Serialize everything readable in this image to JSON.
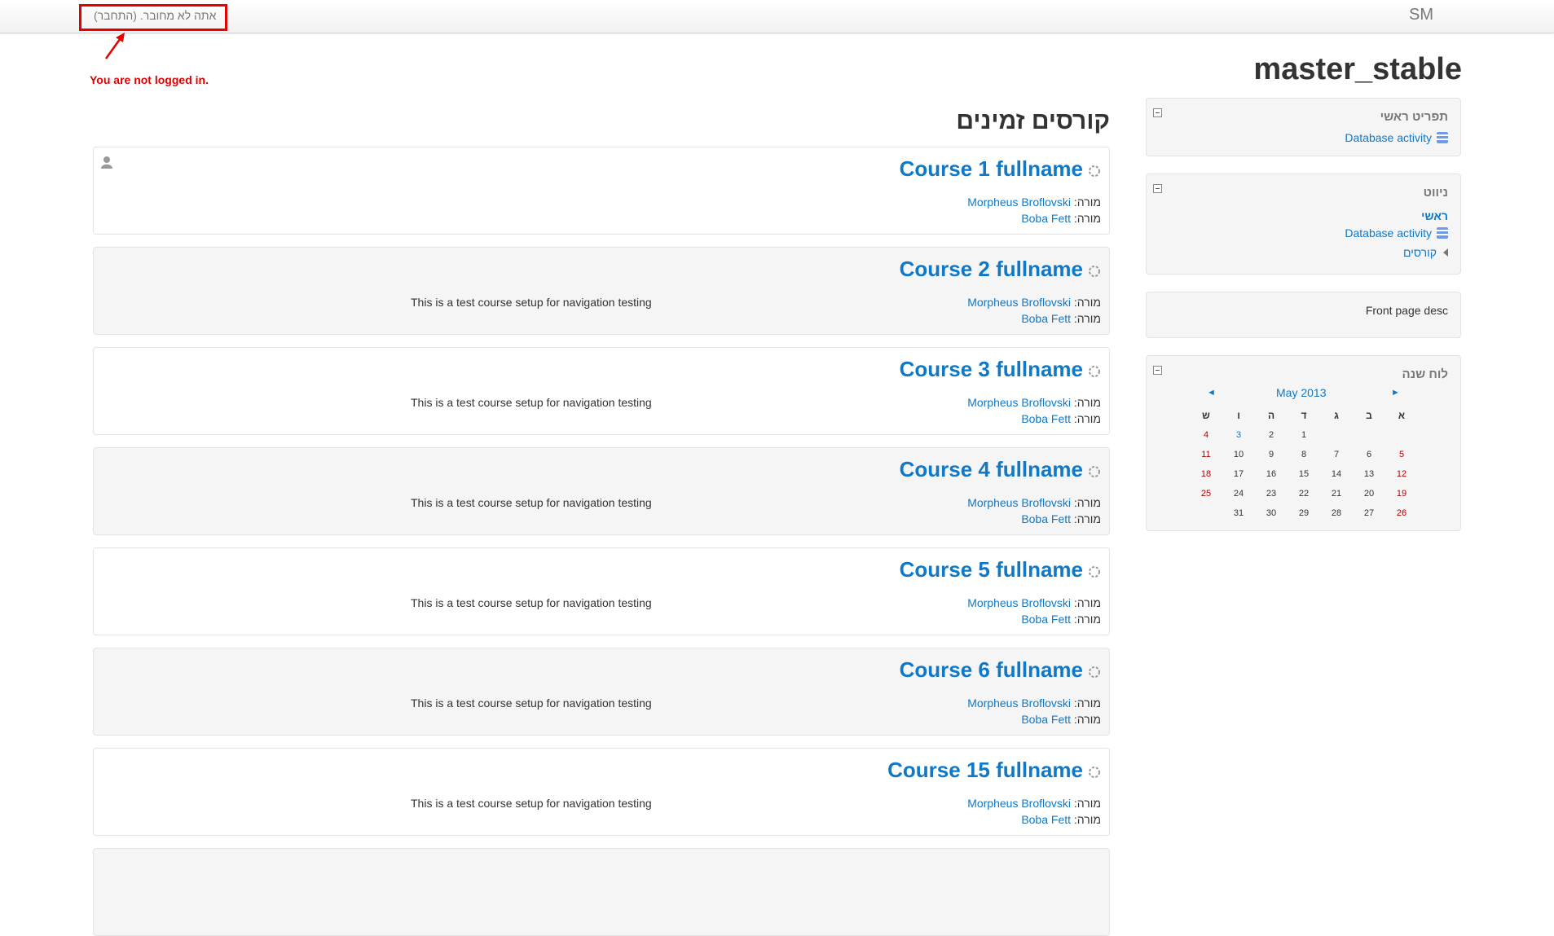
{
  "navbar": {
    "brand": "SM",
    "login_info": "אתה לא מחובר. (התחבר)"
  },
  "annotation": {
    "text": "You are not logged in."
  },
  "site": {
    "title": "master_stable"
  },
  "main": {
    "heading": "קורסים זמינים",
    "teacher_role": "מורה:",
    "courses": [
      {
        "name": "Course 1 fullname",
        "summary": "",
        "teachers": [
          "Morpheus Broflovski",
          "Boba Fett"
        ]
      },
      {
        "name": "Course 2 fullname",
        "summary": "This is a test course setup for navigation testing",
        "teachers": [
          "Morpheus Broflovski",
          "Boba Fett"
        ]
      },
      {
        "name": "Course 3 fullname",
        "summary": "This is a test course setup for navigation testing",
        "teachers": [
          "Morpheus Broflovski",
          "Boba Fett"
        ]
      },
      {
        "name": "Course 4 fullname",
        "summary": "This is a test course setup for navigation testing",
        "teachers": [
          "Morpheus Broflovski",
          "Boba Fett"
        ]
      },
      {
        "name": "Course 5 fullname",
        "summary": "This is a test course setup for navigation testing",
        "teachers": [
          "Morpheus Broflovski",
          "Boba Fett"
        ]
      },
      {
        "name": "Course 6 fullname",
        "summary": "This is a test course setup for navigation testing",
        "teachers": [
          "Morpheus Broflovski",
          "Boba Fett"
        ]
      },
      {
        "name": "Course 15 fullname",
        "summary": "This is a test course setup for navigation testing",
        "teachers": [
          "Morpheus Broflovski",
          "Boba Fett"
        ]
      }
    ]
  },
  "sidebar": {
    "main_menu": {
      "title": "תפריט ראשי",
      "item": "Database activity"
    },
    "navigation": {
      "title": "ניווט",
      "home": "ראשי",
      "item": "Database activity",
      "courses": "קורסים"
    },
    "front_desc": {
      "text": "Front page desc"
    },
    "calendar": {
      "title": "לוח שנה",
      "month": "May 2013",
      "prev": "◄",
      "next": "►",
      "weekdays": [
        "א",
        "ב",
        "ג",
        "ד",
        "ה",
        "ו",
        "ש"
      ],
      "weeks": [
        [
          "",
          "",
          "",
          "1",
          "2",
          "3",
          "4"
        ],
        [
          "5",
          "6",
          "7",
          "8",
          "9",
          "10",
          "11"
        ],
        [
          "12",
          "13",
          "14",
          "15",
          "16",
          "17",
          "18"
        ],
        [
          "19",
          "20",
          "21",
          "22",
          "23",
          "24",
          "25"
        ],
        [
          "26",
          "27",
          "28",
          "29",
          "30",
          "31",
          ""
        ]
      ]
    }
  }
}
